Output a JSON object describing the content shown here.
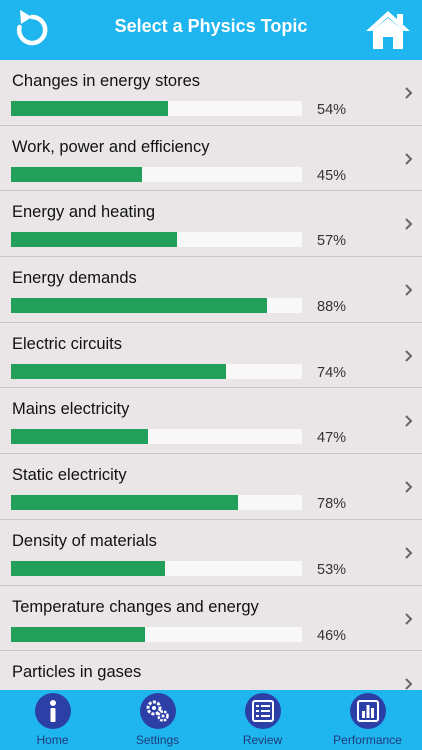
{
  "header": {
    "title": "Select a Physics Topic",
    "back_icon": "refresh-back-icon",
    "home_icon": "home-icon"
  },
  "colors": {
    "header_bg": "#1fb5ee",
    "progress_fill": "#22a05b",
    "tab_icon_bg": "#2c3fa6"
  },
  "topics": [
    {
      "label": "Changes in energy stores",
      "percent_text": "54%",
      "progress": 0.54
    },
    {
      "label": "Work, power and efficiency",
      "percent_text": "45%",
      "progress": 0.45
    },
    {
      "label": "Energy and heating",
      "percent_text": "57%",
      "progress": 0.57
    },
    {
      "label": "Energy demands",
      "percent_text": "88%",
      "progress": 0.88
    },
    {
      "label": "Electric circuits",
      "percent_text": "74%",
      "progress": 0.74
    },
    {
      "label": "Mains electricity",
      "percent_text": "47%",
      "progress": 0.47
    },
    {
      "label": "Static electricity",
      "percent_text": "78%",
      "progress": 0.78
    },
    {
      "label": "Density of materials",
      "percent_text": "53%",
      "progress": 0.53
    },
    {
      "label": "Temperature changes and energy",
      "percent_text": "46%",
      "progress": 0.46
    },
    {
      "label": "Particles in gases",
      "percent_text": "",
      "progress": null
    }
  ],
  "tabs": [
    {
      "label": "Home",
      "icon": "info-icon"
    },
    {
      "label": "Settings",
      "icon": "gears-icon"
    },
    {
      "label": "Review",
      "icon": "list-icon"
    },
    {
      "label": "Performance",
      "icon": "bar-chart-icon"
    }
  ]
}
